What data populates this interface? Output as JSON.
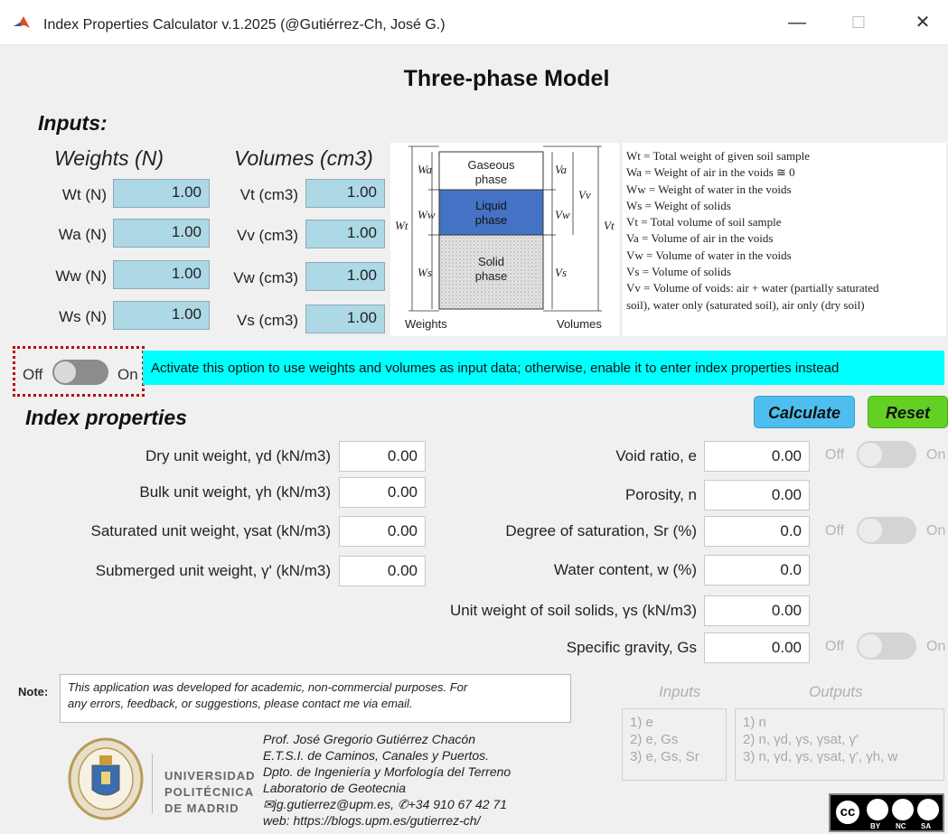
{
  "window": {
    "title": "Index Properties Calculator v.1.2025 (@Gutiérrez-Ch, José G.)",
    "min_glyph": "—",
    "max_glyph": "☐",
    "close_glyph": "✕",
    "app_icon": "matlab-icon"
  },
  "page_title": "Three-phase Model",
  "inputs": {
    "heading": "Inputs:",
    "weights_heading": "Weights (N)",
    "volumes_heading": "Volumes (cm3)",
    "weights": [
      {
        "label": "Wt (N)",
        "value": "1.00"
      },
      {
        "label": "Wa (N)",
        "value": "1.00"
      },
      {
        "label": "Ww (N)",
        "value": "1.00"
      },
      {
        "label": "Ws (N)",
        "value": "1.00"
      }
    ],
    "volumes": [
      {
        "label": "Vt (cm3)",
        "value": "1.00"
      },
      {
        "label": "Vv (cm3)",
        "value": "1.00"
      },
      {
        "label": "Vw (cm3)",
        "value": "1.00"
      },
      {
        "label": "Vs (cm3)",
        "value": "1.00"
      }
    ]
  },
  "diagram": {
    "gaseous": "Gaseous",
    "gaseous2": "phase",
    "liquid": "Liquid",
    "liquid2": "phase",
    "solid": "Solid",
    "solid2": "phase",
    "weights_label": "Weights",
    "volumes_label": "Volumes",
    "wa": "Wa",
    "ww": "Ww",
    "ws": "Ws",
    "wt": "Wt",
    "va": "Va",
    "vw": "Vw",
    "vs": "Vs",
    "vv": "Vv",
    "vt": "Vt",
    "colors": {
      "liquid": "#4472c4",
      "solid": "#d9d9d9",
      "gaseous": "#ffffff"
    }
  },
  "legend": [
    "Wt = Total weight of given soil sample",
    "Wa = Weight of air in the voids ≅ 0",
    "Ww = Weight of water in the voids",
    "Ws = Weight of solids",
    "Vt = Total volume of soil sample",
    "Va = Volume of air in the voids",
    "Vw = Volume of water in the voids",
    "Vs = Volume of solids",
    "Vv = Volume of voids: air + water (partially saturated",
    "soil), water only (saturated soil), air only (dry soil)"
  ],
  "mode_switch": {
    "off": "Off",
    "on": "On",
    "banner": "Activate this option to use weights and volumes as input data; otherwise, enable it to enter index properties instead",
    "banner_color": "#00ffff"
  },
  "index": {
    "heading": "Index properties",
    "calculate": "Calculate",
    "reset": "Reset",
    "left": [
      {
        "label": "Dry unit weight, γd (kN/m3)",
        "value": "0.00"
      },
      {
        "label": "Bulk unit weight, γh (kN/m3)",
        "value": "0.00"
      },
      {
        "label": "Saturated unit weight, γsat (kN/m3)",
        "value": "0.00"
      },
      {
        "label": "Submerged unit weight, γ' (kN/m3)",
        "value": "0.00"
      }
    ],
    "right": [
      {
        "label": "Void ratio, e",
        "value": "0.00"
      },
      {
        "label": "Porosity, n",
        "value": "0.00"
      },
      {
        "label": "Degree of saturation, Sr (%)",
        "value": "0.0"
      },
      {
        "label": "Water content, w (%)",
        "value": "0.0"
      },
      {
        "label": "Unit weight of soil solids, γs (kN/m3)",
        "value": "0.00"
      },
      {
        "label": "Specific gravity, Gs",
        "value": "0.00"
      }
    ],
    "switch_off": "Off",
    "switch_on": "On"
  },
  "note": {
    "label": "Note:",
    "text1": "This application was developed for academic, non-commercial purposes. For",
    "text2": "any errors, feedback, or suggestions, please contact me via email."
  },
  "io_panel": {
    "inputs_heading": "Inputs",
    "outputs_heading": "Outputs",
    "inputs_text": "1) e\n2) e, Gs\n3) e, Gs, Sr",
    "outputs_text": "1) n\n2) n, γd, γs, γsat, γ'\n3) n, γd, γs, γsat, γ', γh, w"
  },
  "university": {
    "line1": "UNIVERSIDAD",
    "line2": "POLITÉCNICA",
    "line3": "DE MADRID"
  },
  "credits": [
    "Prof. José Gregorio Gutiérrez Chacón",
    "E.T.S.I. de Caminos, Canales y Puertos.",
    "Dpto. de Ingeniería y Morfología del Terreno",
    "Laboratorio de Geotecnia",
    "✉jg.gutierrez@upm.es, ✆+34 910 67 42 71",
    "web: https://blogs.upm.es/gutierrez-ch/"
  ],
  "license": {
    "cc": "cc",
    "by": "BY",
    "nc": "NC",
    "sa": "SA"
  }
}
